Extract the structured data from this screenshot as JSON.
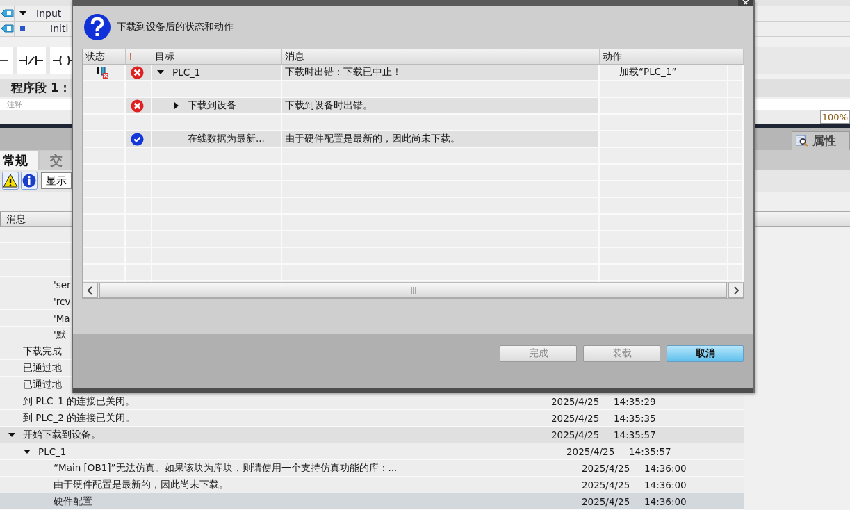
{
  "editor": {
    "interface_rows": [
      {
        "name": "Input",
        "expanded": true
      },
      {
        "name": "Initi",
        "expanded": false
      }
    ],
    "network": {
      "title": "程序段 1：",
      "comment_placeholder": "注释"
    },
    "zoom": "100%",
    "inspector_tab": "属性",
    "tabs": [
      {
        "label": "常规",
        "selected": true
      },
      {
        "label": "交",
        "selected": false
      }
    ],
    "filter_button": "显示"
  },
  "log": {
    "columns": [
      "消息"
    ],
    "rows": [
      {
        "kind": "detail",
        "selected": false
      },
      {
        "kind": "detail",
        "selected": false
      },
      {
        "kind": "detail",
        "selected": false
      },
      {
        "kind": "detail",
        "message": "'ser",
        "selected": false
      },
      {
        "kind": "detail",
        "message": "'rcv",
        "selected": false
      },
      {
        "kind": "detail",
        "message": "'Ma",
        "selected": false
      },
      {
        "kind": "detail",
        "message": "'默",
        "selected": false
      },
      {
        "kind": "entry",
        "message": "下载完成",
        "selected": false
      },
      {
        "kind": "entry",
        "message": "已通过地",
        "selected": false
      },
      {
        "kind": "entry",
        "message": "已通过地",
        "selected": false
      },
      {
        "kind": "entry",
        "message": "到 PLC_1 的连接已关闭。",
        "date": "2025/4/25",
        "time": "14:35:29",
        "selected": false
      },
      {
        "kind": "entry",
        "message": "到 PLC_2 的连接已关闭。",
        "date": "2025/4/25",
        "time": "14:35:35",
        "selected": false
      },
      {
        "kind": "group",
        "message": "开始下载到设备。",
        "date": "2025/4/25",
        "time": "14:35:57",
        "expanded": true,
        "selected": false,
        "children": [
          {
            "kind": "entry",
            "message": "PLC_1",
            "date": "2025/4/25",
            "time": "14:35:57",
            "expanded": true,
            "selected": false,
            "children": [
              {
                "kind": "entry",
                "message": "“Main [OB1]”无法仿真。如果该块为库块，则请使用一个支持仿真功能的库：...",
                "date": "2025/4/25",
                "time": "14:36:00",
                "selected": false
              },
              {
                "kind": "entry",
                "message": "由于硬件配置是最新的，因此尚未下载。",
                "date": "2025/4/25",
                "time": "14:36:00",
                "selected": false
              },
              {
                "kind": "entry",
                "message": "硬件配置",
                "date": "2025/4/25",
                "time": "14:36:00",
                "selected": true
              }
            ]
          }
        ]
      }
    ]
  },
  "dialog": {
    "heading": "下载到设备后的状态和动作",
    "columns": [
      "状态",
      "!",
      "目标",
      "消息",
      "动作"
    ],
    "results": [
      {
        "download_failed": true,
        "kind": "error",
        "target": "PLC_1",
        "expanded": true,
        "message": "下载时出错：下载已中止！",
        "action": "加载“PLC_1”",
        "children": [
          {
            "download_failed": false,
            "kind": "error",
            "target": "下载到设备",
            "expanded": false,
            "message": "下载到设备时出错。"
          },
          {
            "download_failed": false,
            "kind": "ok",
            "target": "在线数据为最新...",
            "message": "由于硬件配置是最新的，因此尚未下载。"
          }
        ]
      }
    ],
    "buttons": [
      {
        "label": "完成",
        "disabled": true,
        "kind": "normal"
      },
      {
        "label": "装载",
        "disabled": true,
        "kind": "normal"
      },
      {
        "label": "取消",
        "disabled": false,
        "kind": "default"
      }
    ]
  }
}
